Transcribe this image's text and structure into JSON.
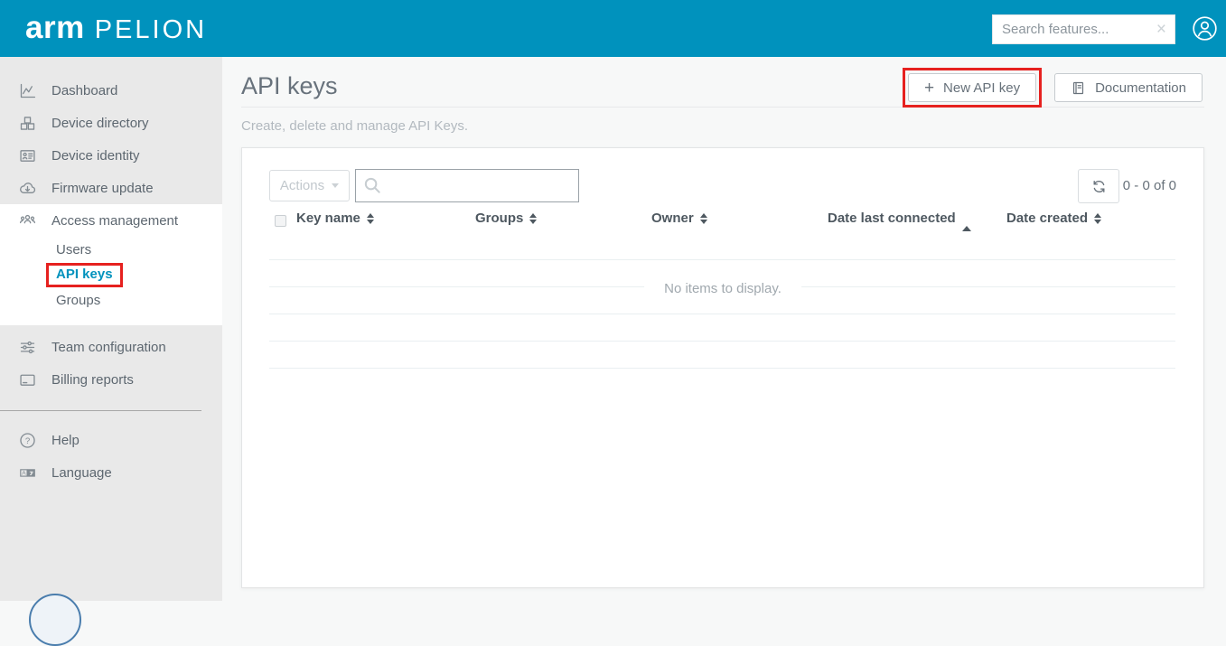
{
  "colors": {
    "brand_teal": "#0092BD",
    "annotation_red": "#E6211F",
    "active_link": "#0092BD"
  },
  "header": {
    "logo_primary": "arm",
    "logo_secondary": "PELION",
    "search_placeholder": "Search features...",
    "clear_label": "×"
  },
  "sidebar": {
    "top_items": [
      {
        "label": "Dashboard"
      },
      {
        "label": "Device directory"
      },
      {
        "label": "Device identity"
      },
      {
        "label": "Firmware update"
      }
    ],
    "access": {
      "label": "Access management",
      "subitems": [
        {
          "label": "Users"
        },
        {
          "label": "API keys",
          "active": true
        },
        {
          "label": "Groups"
        }
      ]
    },
    "mid_items": [
      {
        "label": "Team configuration"
      },
      {
        "label": "Billing reports"
      }
    ],
    "bottom_items": [
      {
        "label": "Help"
      },
      {
        "label": "Language"
      }
    ]
  },
  "page": {
    "title": "API keys",
    "subtitle": "Create, delete and manage API Keys.",
    "plus_glyph": "+",
    "new_api_key_label": "New API key",
    "documentation_label": "Documentation"
  },
  "toolbar": {
    "actions_label": "Actions",
    "count": "0 - 0 of 0"
  },
  "table": {
    "columns": [
      {
        "label": "Key name",
        "sort": "both"
      },
      {
        "label": "Groups",
        "sort": "both"
      },
      {
        "label": "Owner",
        "sort": "both"
      },
      {
        "label": "Date last connected",
        "sort": "asc"
      },
      {
        "label": "Date created",
        "sort": "both"
      }
    ],
    "empty_message": "No items to display."
  }
}
